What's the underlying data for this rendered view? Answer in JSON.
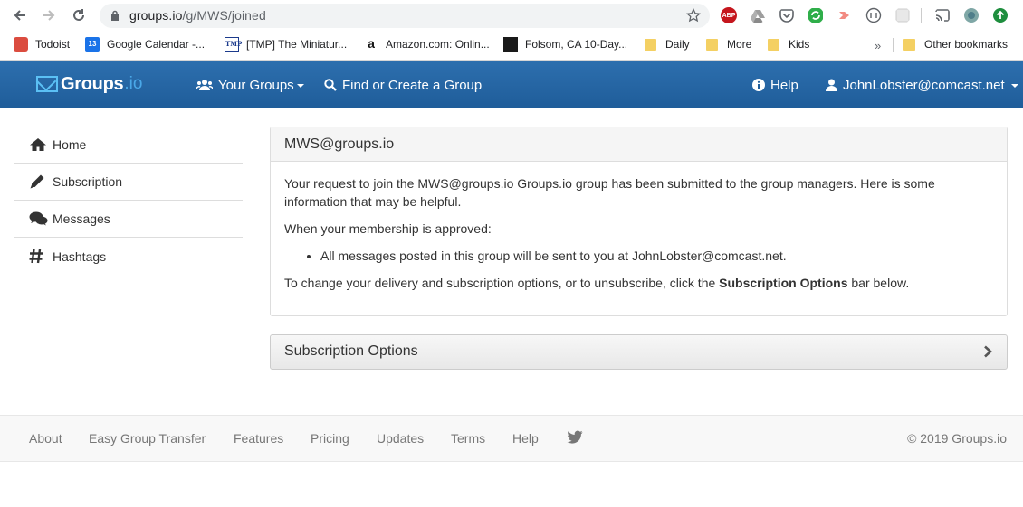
{
  "browser": {
    "url_host": "groups.io",
    "url_path": "/g/MWS/joined",
    "bookmarks": [
      {
        "label": "Todoist",
        "icon": "todoist-icon"
      },
      {
        "label": "Google Calendar -...",
        "icon": "google-calendar-icon"
      },
      {
        "label": "[TMP] The Miniatur...",
        "icon": "tmp-icon"
      },
      {
        "label": "Amazon.com: Onlin...",
        "icon": "amazon-icon"
      },
      {
        "label": "Folsom, CA 10-Day...",
        "icon": "weather-underground-icon"
      },
      {
        "label": "Daily",
        "icon": "folder-icon"
      },
      {
        "label": "More",
        "icon": "folder-icon"
      },
      {
        "label": "Kids",
        "icon": "folder-icon"
      }
    ],
    "overflow_label": "»",
    "other_bookmarks": "Other bookmarks",
    "extension_abp_label": "ABP"
  },
  "navbar": {
    "brand": "Groups",
    "brand_tld": ".io",
    "your_groups": "Your Groups",
    "find_create": "Find or Create a Group",
    "help": "Help",
    "user": "JohnLobster@comcast.net"
  },
  "sidebar": {
    "items": [
      {
        "label": "Home",
        "icon": "home-icon"
      },
      {
        "label": "Subscription",
        "icon": "pencil-icon"
      },
      {
        "label": "Messages",
        "icon": "comments-icon"
      },
      {
        "label": "Hashtags",
        "icon": "hashtag-icon"
      }
    ]
  },
  "main": {
    "panel_title": "MWS@groups.io",
    "para1": "Your request to join the MWS@groups.io Groups.io group has been submitted to the group managers. Here is some information that may be helpful.",
    "para2": "When your membership is approved:",
    "bullet1": "All messages posted in this group will be sent to you at JohnLobster@comcast.net.",
    "para3_pre": "To change your delivery and subscription options, or to unsubscribe, click the ",
    "para3_bold": "Subscription Options",
    "para3_post": " bar below.",
    "subscription_options": "Subscription Options"
  },
  "footer": {
    "links": [
      "About",
      "Easy Group Transfer",
      "Features",
      "Pricing",
      "Updates",
      "Terms",
      "Help"
    ],
    "copyright": "© 2019 Groups.io"
  },
  "colors": {
    "navbar": "#1f5d9a",
    "brand_tld": "#4aa8e8",
    "footer_text": "#777777"
  }
}
